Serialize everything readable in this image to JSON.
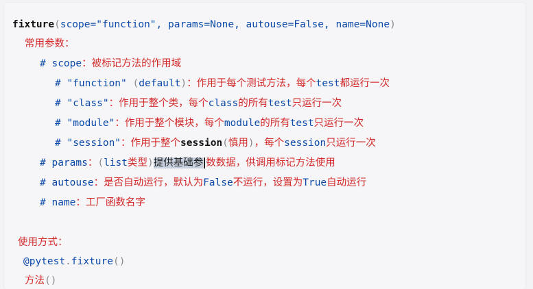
{
  "lines": {
    "sig": {
      "fn": "fixture",
      "open": "(",
      "p1_name": "scope",
      "p1_eq": "=",
      "p1_val": "\"function\"",
      "sep1": ", ",
      "p2_name": "params",
      "p2_eq": "=",
      "p2_val": "None",
      "sep2": ", ",
      "p3_name": "autouse",
      "p3_eq": "=",
      "p3_val": "False",
      "sep3": ", ",
      "p4_name": "name",
      "p4_eq": "=",
      "p4_val": "None",
      "close": ")"
    },
    "common_params": "常用参数：",
    "scope_line": {
      "hash": "#",
      "name": "scope",
      "colon": "：",
      "desc": "被标记方法的作用域"
    },
    "function_line": {
      "hash": "#",
      "val": "\"function\"",
      "default_open": "(",
      "default_word": "default",
      "default_close": ")",
      "colon": "：",
      "desc1": "作用于每个测试方法，每个",
      "kw": "test",
      "desc2": "都运行一次"
    },
    "class_line": {
      "hash": "#",
      "val": "\"class\"",
      "colon": "：",
      "desc1": "作用于整个类，每个",
      "kw1": "class",
      "desc2": "的所有",
      "kw2": "test",
      "desc3": "只运行一次"
    },
    "module_line": {
      "hash": "#",
      "val": "\"module\"",
      "colon": "：",
      "desc1": "作用于整个模块，每个",
      "kw1": "module",
      "desc2": "的所有",
      "kw2": "test",
      "desc3": "只运行一次"
    },
    "session_line": {
      "hash": "#",
      "val": "\"session\"",
      "colon": "：",
      "desc1": "作用于整个",
      "kw1": "session",
      "paren_open": "(",
      "cautious": "慎用",
      "paren_close": ")",
      "desc2": "，每个",
      "kw2": "session",
      "desc3": "只运行一次"
    },
    "params_line": {
      "hash": "#",
      "name": "params",
      "colon": "：",
      "paren_open": "(",
      "list": "list",
      "type_word": "类型",
      "paren_close": ")",
      "selected": "提供基础参",
      "after_sel": "数数据，供调用标记方法使用"
    },
    "autouse_line": {
      "hash": "#",
      "name": "autouse",
      "colon": "：",
      "desc1": "是否自动运行，默认为",
      "kw1": "False",
      "desc2": "不运行，设置为",
      "kw2": "True",
      "desc3": "自动运行"
    },
    "name_line": {
      "hash": "#",
      "name": "name",
      "colon": "：",
      "desc": "工厂函数名字"
    },
    "usage": "使用方式：",
    "decorator": {
      "at": "@",
      "mod": "pytest",
      "dot": ".",
      "attr": "fixture",
      "parens": "()"
    },
    "method": {
      "word": "方法",
      "parens": "()"
    }
  },
  "colors": {
    "keyword_blue": "#0b4aa8",
    "comment_red": "#d32a2a",
    "text_black": "#1e1e1e",
    "paren_gray": "#8a8a8a",
    "selection": "#c7d1df"
  }
}
